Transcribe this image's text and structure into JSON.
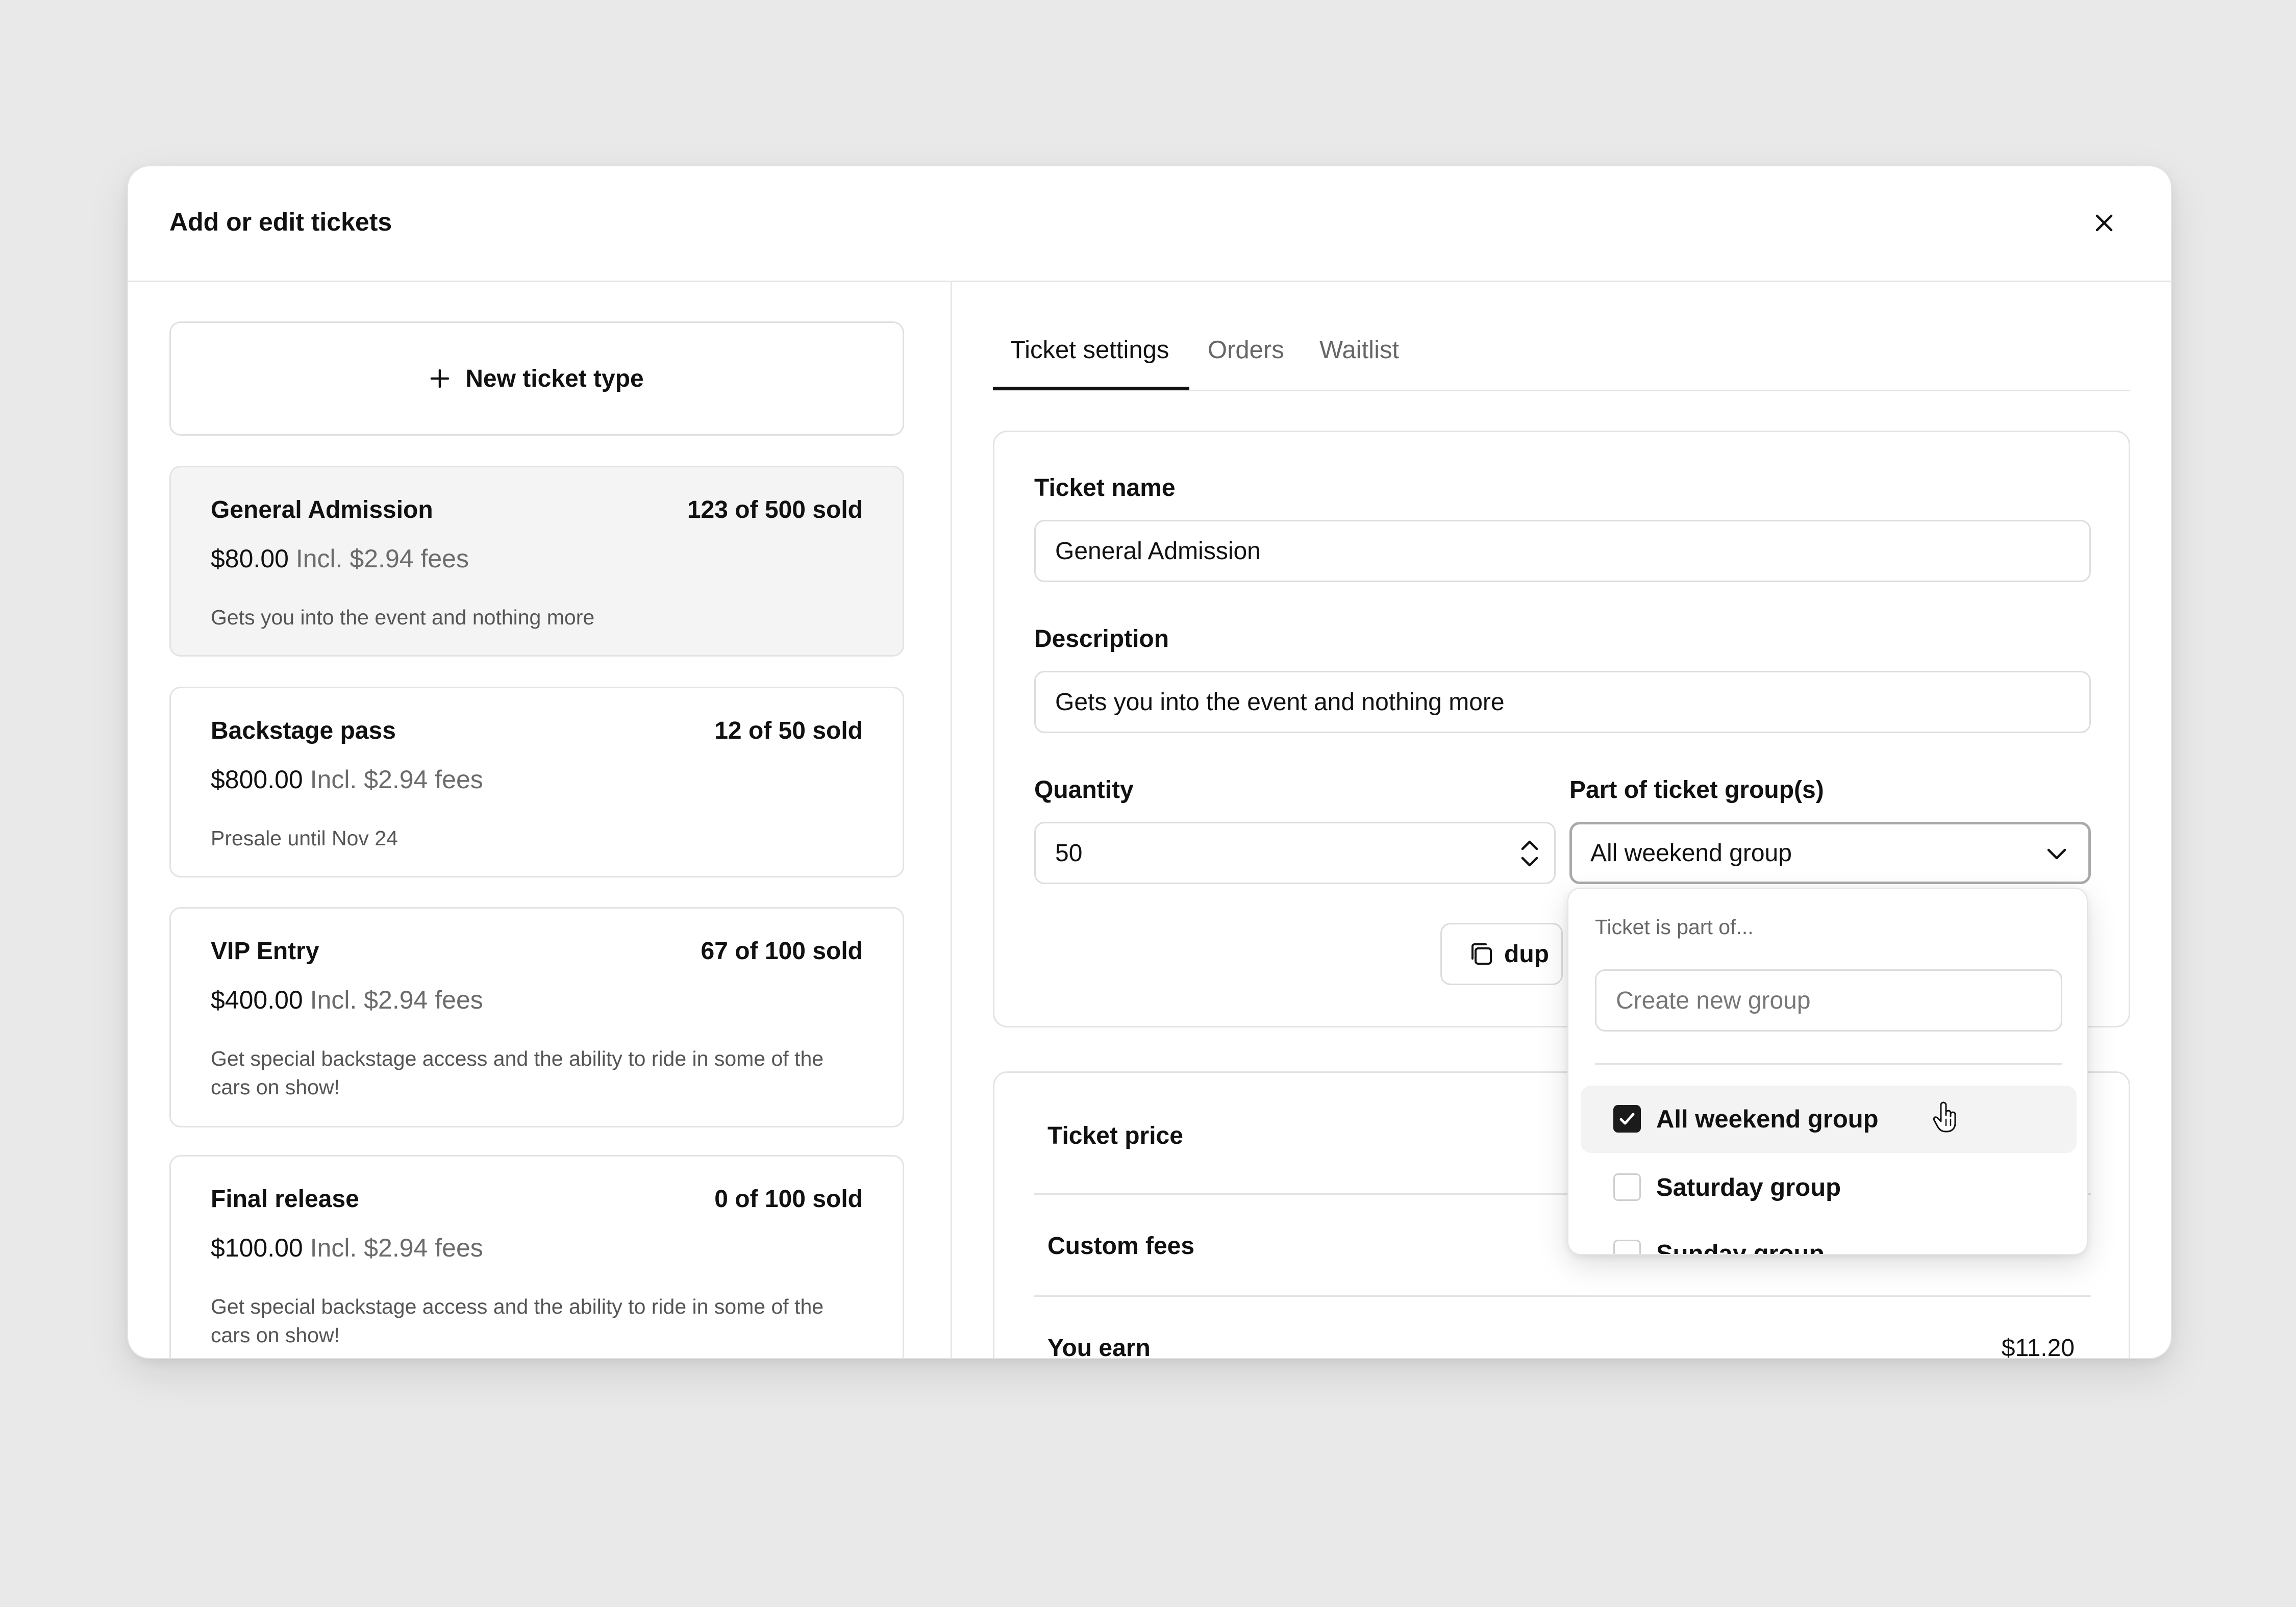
{
  "modal": {
    "title": "Add or edit tickets",
    "close_icon": "close-icon"
  },
  "left": {
    "new_ticket_label": "New ticket type",
    "tickets": [
      {
        "name": "General Admission",
        "sold": "123 of 500 sold",
        "price": "$80.00",
        "fees": "Incl. $2.94 fees",
        "description": "Gets you into the event and nothing more",
        "selected": true
      },
      {
        "name": "Backstage pass",
        "sold": "12 of 50 sold",
        "price": "$800.00",
        "fees": "Incl. $2.94 fees",
        "description": "Presale until Nov 24"
      },
      {
        "name": "VIP Entry",
        "sold": "67 of 100 sold",
        "price": "$400.00",
        "fees": "Incl. $2.94 fees",
        "description": "Get special backstage access and the ability to ride in some of the cars on show!"
      },
      {
        "name": "Final release",
        "sold": "0 of 100 sold",
        "price": "$100.00",
        "fees": "Incl. $2.94 fees",
        "description": "Get special backstage access and the ability to ride in some of the cars on show!"
      }
    ]
  },
  "tabs": [
    {
      "label": "Ticket settings",
      "active": true
    },
    {
      "label": "Orders"
    },
    {
      "label": "Waitlist"
    }
  ],
  "form": {
    "ticket_name_label": "Ticket name",
    "ticket_name_value": "General Admission",
    "description_label": "Description",
    "description_value": "Gets you into the event and nothing more",
    "quantity_label": "Quantity",
    "quantity_value": "50",
    "group_label": "Part of ticket group(s)",
    "group_value": "All weekend group",
    "duplicate_label": "dup"
  },
  "pricing": {
    "ticket_price_label": "Ticket price",
    "custom_fees_label": "Custom fees",
    "you_earn_label": "You earn",
    "you_earn_value": "$11.20"
  },
  "dropdown": {
    "caption": "Ticket is part of...",
    "create_placeholder": "Create new group",
    "options": [
      {
        "label": "All weekend group",
        "checked": true
      },
      {
        "label": "Saturday group",
        "checked": false
      },
      {
        "label": "Sunday group",
        "checked": false
      }
    ]
  },
  "colors": {
    "accent": "#111111",
    "muted_text": "#666666",
    "border": "#e3e3e3",
    "selected_bg": "#f4f4f4",
    "page_bg": "#e9e9e9"
  }
}
